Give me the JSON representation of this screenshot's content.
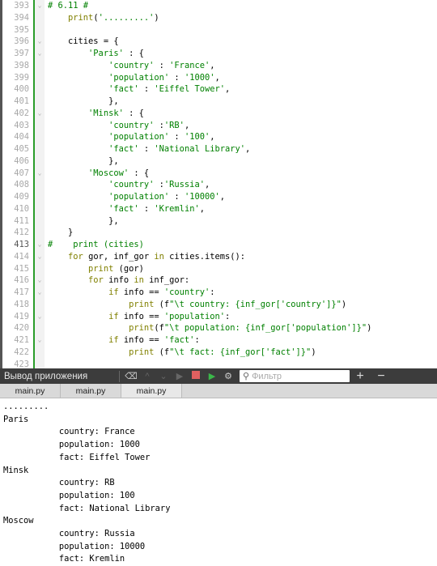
{
  "editor": {
    "current_line": 413,
    "lines": [
      {
        "n": 393,
        "fold": true,
        "seg": [
          [
            "cm",
            "# 6.11 #"
          ]
        ]
      },
      {
        "n": 394,
        "seg": [
          [
            "",
            "    "
          ],
          [
            "fn",
            "print"
          ],
          [
            "",
            "("
          ],
          [
            "str",
            "'.........'"
          ],
          [
            "",
            ")"
          ]
        ]
      },
      {
        "n": 395,
        "seg": []
      },
      {
        "n": 396,
        "fold": true,
        "seg": [
          [
            "",
            "    cities = {"
          ]
        ]
      },
      {
        "n": 397,
        "fold": true,
        "seg": [
          [
            "",
            "        "
          ],
          [
            "str",
            "'Paris'"
          ],
          [
            "",
            " : {"
          ]
        ]
      },
      {
        "n": 398,
        "seg": [
          [
            "",
            "            "
          ],
          [
            "str",
            "'country'"
          ],
          [
            "",
            " : "
          ],
          [
            "str",
            "'France'"
          ],
          [
            "",
            ","
          ]
        ]
      },
      {
        "n": 399,
        "seg": [
          [
            "",
            "            "
          ],
          [
            "str",
            "'population'"
          ],
          [
            "",
            " : "
          ],
          [
            "str",
            "'1000'"
          ],
          [
            "",
            ","
          ]
        ]
      },
      {
        "n": 400,
        "seg": [
          [
            "",
            "            "
          ],
          [
            "str",
            "'fact'"
          ],
          [
            "",
            " : "
          ],
          [
            "str",
            "'Eiffel Tower'"
          ],
          [
            "",
            ","
          ]
        ]
      },
      {
        "n": 401,
        "seg": [
          [
            "",
            "            },"
          ]
        ]
      },
      {
        "n": 402,
        "fold": true,
        "seg": [
          [
            "",
            "        "
          ],
          [
            "str",
            "'Minsk'"
          ],
          [
            "",
            " : {"
          ]
        ]
      },
      {
        "n": 403,
        "seg": [
          [
            "",
            "            "
          ],
          [
            "str",
            "'country'"
          ],
          [
            "",
            " :"
          ],
          [
            "str",
            "'RB'"
          ],
          [
            "",
            ","
          ]
        ]
      },
      {
        "n": 404,
        "seg": [
          [
            "",
            "            "
          ],
          [
            "str",
            "'population'"
          ],
          [
            "",
            " : "
          ],
          [
            "str",
            "'100'"
          ],
          [
            "",
            ","
          ]
        ]
      },
      {
        "n": 405,
        "seg": [
          [
            "",
            "            "
          ],
          [
            "str",
            "'fact'"
          ],
          [
            "",
            " : "
          ],
          [
            "str",
            "'National Library'"
          ],
          [
            "",
            ","
          ]
        ]
      },
      {
        "n": 406,
        "seg": [
          [
            "",
            "            },"
          ]
        ]
      },
      {
        "n": 407,
        "fold": true,
        "seg": [
          [
            "",
            "        "
          ],
          [
            "str",
            "'Moscow'"
          ],
          [
            "",
            " : {"
          ]
        ]
      },
      {
        "n": 408,
        "seg": [
          [
            "",
            "            "
          ],
          [
            "str",
            "'country'"
          ],
          [
            "",
            " :"
          ],
          [
            "str",
            "'Russia'"
          ],
          [
            "",
            ","
          ]
        ]
      },
      {
        "n": 409,
        "seg": [
          [
            "",
            "            "
          ],
          [
            "str",
            "'population'"
          ],
          [
            "",
            " : "
          ],
          [
            "str",
            "'10000'"
          ],
          [
            "",
            ","
          ]
        ]
      },
      {
        "n": 410,
        "seg": [
          [
            "",
            "            "
          ],
          [
            "str",
            "'fact'"
          ],
          [
            "",
            " : "
          ],
          [
            "str",
            "'Kremlin'"
          ],
          [
            "",
            ","
          ]
        ]
      },
      {
        "n": 411,
        "seg": [
          [
            "",
            "            },"
          ]
        ]
      },
      {
        "n": 412,
        "seg": [
          [
            "",
            "    }"
          ]
        ]
      },
      {
        "n": 413,
        "fold": true,
        "seg": [
          [
            "cm",
            "#    print (cities)"
          ]
        ]
      },
      {
        "n": 414,
        "fold": true,
        "seg": [
          [
            "",
            "    "
          ],
          [
            "kw",
            "for"
          ],
          [
            "",
            " gor, inf_gor "
          ],
          [
            "kw",
            "in"
          ],
          [
            "",
            " cities.items():"
          ]
        ]
      },
      {
        "n": 415,
        "seg": [
          [
            "",
            "        "
          ],
          [
            "fn",
            "print"
          ],
          [
            "",
            " (gor)"
          ]
        ]
      },
      {
        "n": 416,
        "fold": true,
        "seg": [
          [
            "",
            "        "
          ],
          [
            "kw",
            "for"
          ],
          [
            "",
            " info "
          ],
          [
            "kw",
            "in"
          ],
          [
            "",
            " inf_gor:"
          ]
        ]
      },
      {
        "n": 417,
        "fold": true,
        "seg": [
          [
            "",
            "            "
          ],
          [
            "kw",
            "if"
          ],
          [
            "",
            " info == "
          ],
          [
            "str",
            "'country'"
          ],
          [
            "",
            ":"
          ]
        ]
      },
      {
        "n": 418,
        "seg": [
          [
            "",
            "                "
          ],
          [
            "fn",
            "print"
          ],
          [
            "",
            " (f"
          ],
          [
            "str",
            "\"\\t country: {inf_gor['country']}\""
          ],
          [
            "",
            ")"
          ]
        ]
      },
      {
        "n": 419,
        "fold": true,
        "seg": [
          [
            "",
            "            "
          ],
          [
            "kw",
            "if"
          ],
          [
            "",
            " info == "
          ],
          [
            "str",
            "'population'"
          ],
          [
            "",
            ":"
          ]
        ]
      },
      {
        "n": 420,
        "seg": [
          [
            "",
            "                "
          ],
          [
            "fn",
            "print"
          ],
          [
            "",
            "(f"
          ],
          [
            "str",
            "\"\\t population: {inf_gor['population']}\""
          ],
          [
            "",
            ")"
          ]
        ]
      },
      {
        "n": 421,
        "fold": true,
        "seg": [
          [
            "",
            "            "
          ],
          [
            "kw",
            "if"
          ],
          [
            "",
            " info == "
          ],
          [
            "str",
            "'fact'"
          ],
          [
            "",
            ":"
          ]
        ]
      },
      {
        "n": 422,
        "seg": [
          [
            "",
            "                "
          ],
          [
            "fn",
            "print"
          ],
          [
            "",
            " (f"
          ],
          [
            "str",
            "\"\\t fact: {inf_gor['fact']}\""
          ],
          [
            "",
            ")"
          ]
        ]
      },
      {
        "n": 423,
        "seg": []
      }
    ]
  },
  "output_pane": {
    "title": "Вывод приложения",
    "filter_placeholder": "Фильтр",
    "tabs": [
      {
        "label": "main.py"
      },
      {
        "label": "main.py"
      },
      {
        "label": "main.py",
        "active": true
      }
    ],
    "text": ".........\nParis\n\t country: France\n\t population: 1000\n\t fact: Eiffel Tower\nMinsk\n\t country: RB\n\t population: 100\n\t fact: National Library\nMoscow\n\t country: Russia\n\t population: 10000\n\t fact: Kremlin"
  },
  "colors": {
    "keyword": "#808000",
    "string": "#008000",
    "comment": "#008000",
    "stop": "#e06060",
    "panel": "#3c3c3c"
  }
}
